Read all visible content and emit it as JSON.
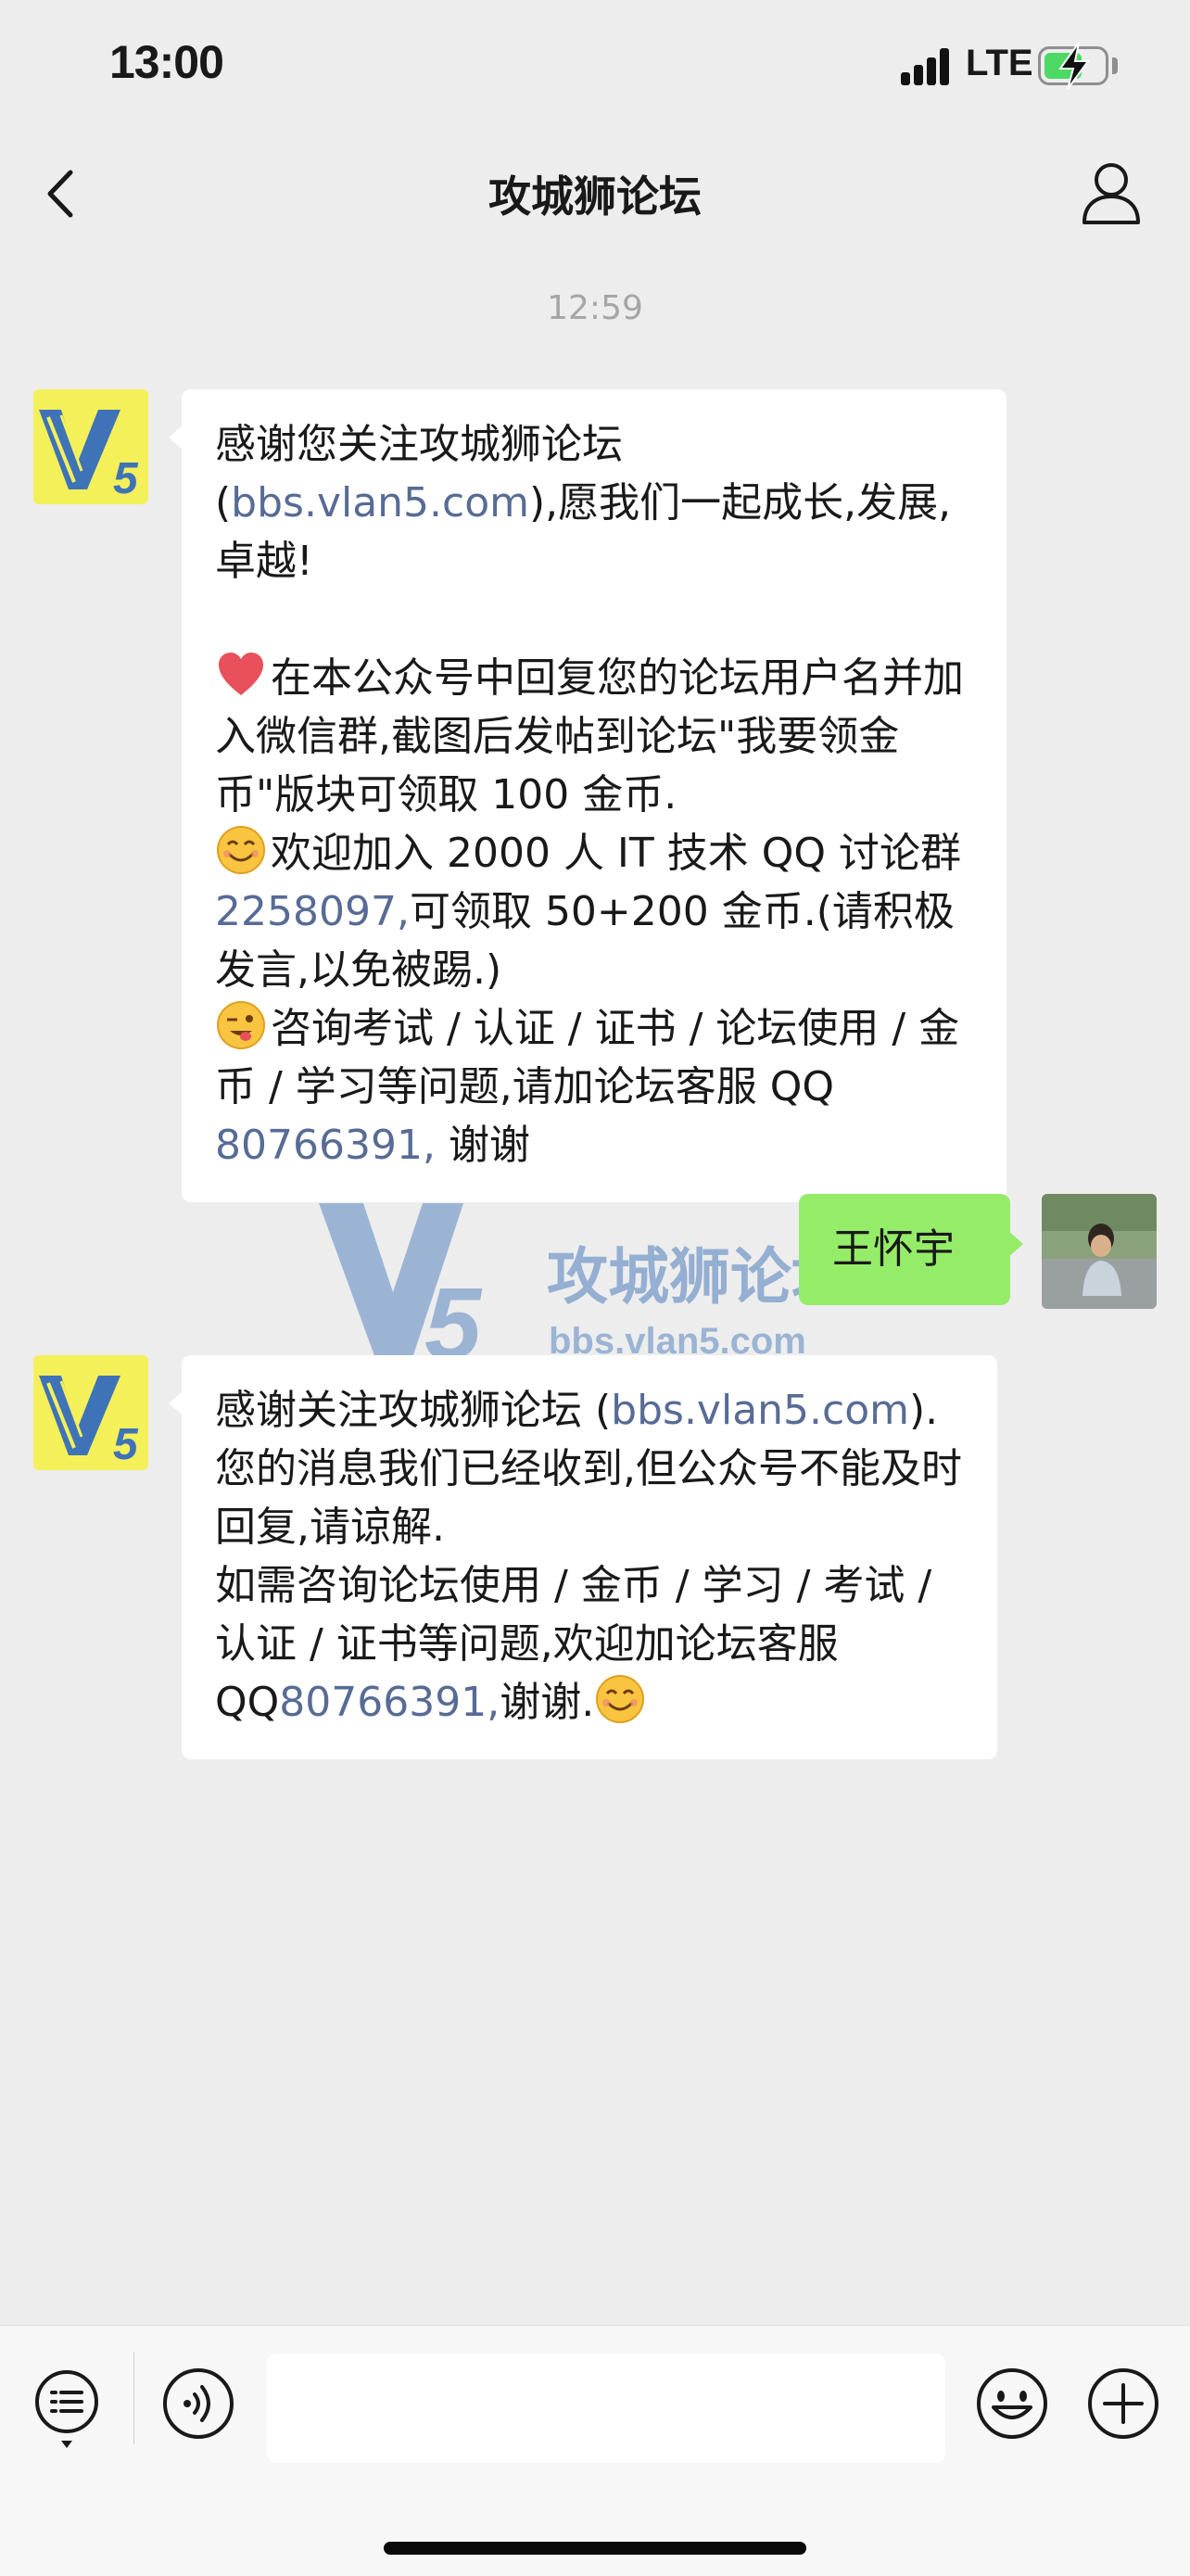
{
  "status_bar": {
    "time": "13:00",
    "network": "LTE",
    "battery_charging": true
  },
  "nav": {
    "title": "攻城狮论坛",
    "back_icon": "chevron-left-icon",
    "profile_icon": "person-icon"
  },
  "timestamp": "12:59",
  "messages": [
    {
      "direction": "incoming",
      "avatar_text": "V5",
      "intro_before": "感谢您关注攻城狮论坛 (",
      "intro_link": "bbs.vlan5.c",
      "intro_link2": "om",
      "intro_after": "),愿我们一起成长,发展,卓越!",
      "p1_emoji": "heart-emoji",
      "p1_text": "在本公众号中回复您的论坛用户名并加入微信群,截图后发帖到论坛\"我要领金币\"版块可领取 100 金币.",
      "p2_emoji": "smile-emoji",
      "p2_before": "欢迎加入 2000 人 IT 技术 QQ 讨论群",
      "p2_link": "2258097,",
      "p2_after": "可领取 50+200 金币.(请积极发言,以免被踢.)",
      "p3_emoji": "wink-emoji",
      "p3_before": "咨询考试 / 认证 / 证书 / 论坛使用 / 金币 / 学习等问题,请加论坛客服 QQ ",
      "p3_link": "80766391,",
      "p3_after": " 谢谢"
    },
    {
      "direction": "outgoing",
      "text": "王怀宇"
    },
    {
      "direction": "incoming",
      "avatar_text": "V5",
      "l1_before": "感谢关注攻城狮论坛 (",
      "l1_link": "bbs.vlan5.co",
      "l1_link2": "m",
      "l1_after": ").",
      "l2": "您的消息我们已经收到,但公众号不能及时回复,请谅解.",
      "l3_before": "如需咨询论坛使用 / 金币 / 学习 / 考试 / 认证 / 证书等问题,欢迎加论坛客服 QQ",
      "l3_link": "80766391,",
      "l3_after": "谢谢.",
      "end_emoji": "smile-emoji"
    }
  ],
  "watermark": {
    "logo": "V5",
    "title": "攻城狮论坛",
    "url": "bbs.vlan5.com"
  },
  "input_bar": {
    "menu_icon": "list-menu-icon",
    "voice_icon": "voice-icon",
    "input_value": "",
    "emoji_icon": "emoji-icon",
    "plus_icon": "plus-icon"
  },
  "colors": {
    "background": "#ededed",
    "bubble_in": "#ffffff",
    "bubble_out": "#95ec69",
    "link": "#576b95",
    "timestamp": "#a6a6a6"
  }
}
